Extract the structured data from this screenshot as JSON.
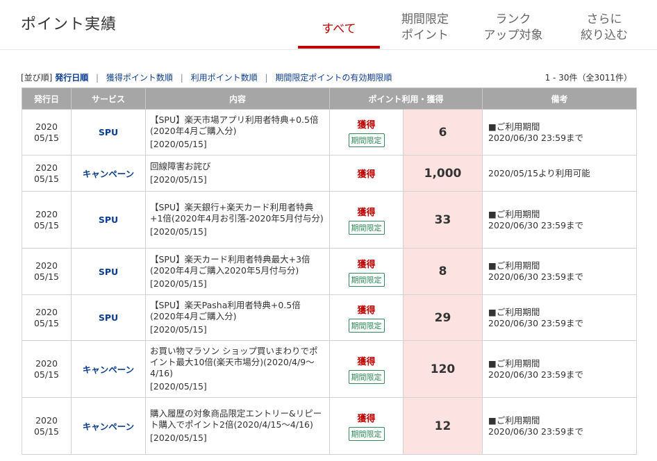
{
  "header": {
    "title": "ポイント実績",
    "tabs": [
      {
        "line1": "すべて",
        "line2": ""
      },
      {
        "line1": "期間限定",
        "line2": "ポイント"
      },
      {
        "line1": "ランク",
        "line2": "アップ対象"
      },
      {
        "line1": "さらに",
        "line2": "絞り込む"
      }
    ]
  },
  "sort": {
    "prefix": "[並び順]",
    "options": [
      "発行日順",
      "獲得ポイント数順",
      "利用ポイント数順",
      "期間限定ポイントの有効期限順"
    ],
    "separator": "|"
  },
  "count": "1 - 30件（全3011件）",
  "table": {
    "headers": [
      "発行日",
      "サービス",
      "内容",
      "ポイント利用・獲得",
      "備考"
    ],
    "rows": [
      {
        "year": "2020",
        "md": "05/15",
        "service": "SPU",
        "content": "【SPU】楽天市場アプリ利用者特典+0.5倍(2020年4月ご購入分)",
        "date": "[2020/05/15]",
        "type": "獲得",
        "badge": "期間限定",
        "points": "6",
        "note1": "■ご利用期間",
        "note2": "2020/06/30 23:59まで"
      },
      {
        "year": "2020",
        "md": "05/15",
        "service": "キャンペーン",
        "content": "回線障害お詫び",
        "date": "[2020/05/15]",
        "type": "獲得",
        "badge": "",
        "points": "1,000",
        "note1": "2020/05/15より利用可能",
        "note2": ""
      },
      {
        "year": "2020",
        "md": "05/15",
        "service": "SPU",
        "content": "【SPU】楽天銀行+楽天カード利用者特典+1倍(2020年4月お引落-2020年5月付与分)",
        "date": "[2020/05/15]",
        "type": "獲得",
        "badge": "期間限定",
        "points": "33",
        "note1": "■ご利用期間",
        "note2": "2020/06/30 23:59まで"
      },
      {
        "year": "2020",
        "md": "05/15",
        "service": "SPU",
        "content": "【SPU】楽天カード利用者特典最大+3倍(2020年4月ご購入2020年5月付与分)",
        "date": "[2020/05/15]",
        "type": "獲得",
        "badge": "期間限定",
        "points": "8",
        "note1": "■ご利用期間",
        "note2": "2020/06/30 23:59まで"
      },
      {
        "year": "2020",
        "md": "05/15",
        "service": "SPU",
        "content": "【SPU】楽天Pasha利用者特典+0.5倍(2020年4月ご購入分)",
        "date": "[2020/05/15]",
        "type": "獲得",
        "badge": "期間限定",
        "points": "29",
        "note1": "■ご利用期間",
        "note2": "2020/06/30 23:59まで"
      },
      {
        "year": "2020",
        "md": "05/15",
        "service": "キャンペーン",
        "content": "お買い物マラソン ショップ買いまわりでポイント最大10倍(楽天市場分)(2020/4/9～4/16)",
        "date": "[2020/05/15]",
        "type": "獲得",
        "badge": "期間限定",
        "points": "120",
        "note1": "■ご利用期間",
        "note2": "2020/06/30 23:59まで"
      },
      {
        "year": "2020",
        "md": "05/15",
        "service": "キャンペーン",
        "content": "購入履歴の対象商品限定エントリー&リピート購入でポイント2倍(2020/4/15～4/16)",
        "date": "[2020/05/15]",
        "type": "獲得",
        "badge": "期間限定",
        "points": "12",
        "note1": "■ご利用期間",
        "note2": "2020/06/30 23:59まで"
      }
    ]
  }
}
